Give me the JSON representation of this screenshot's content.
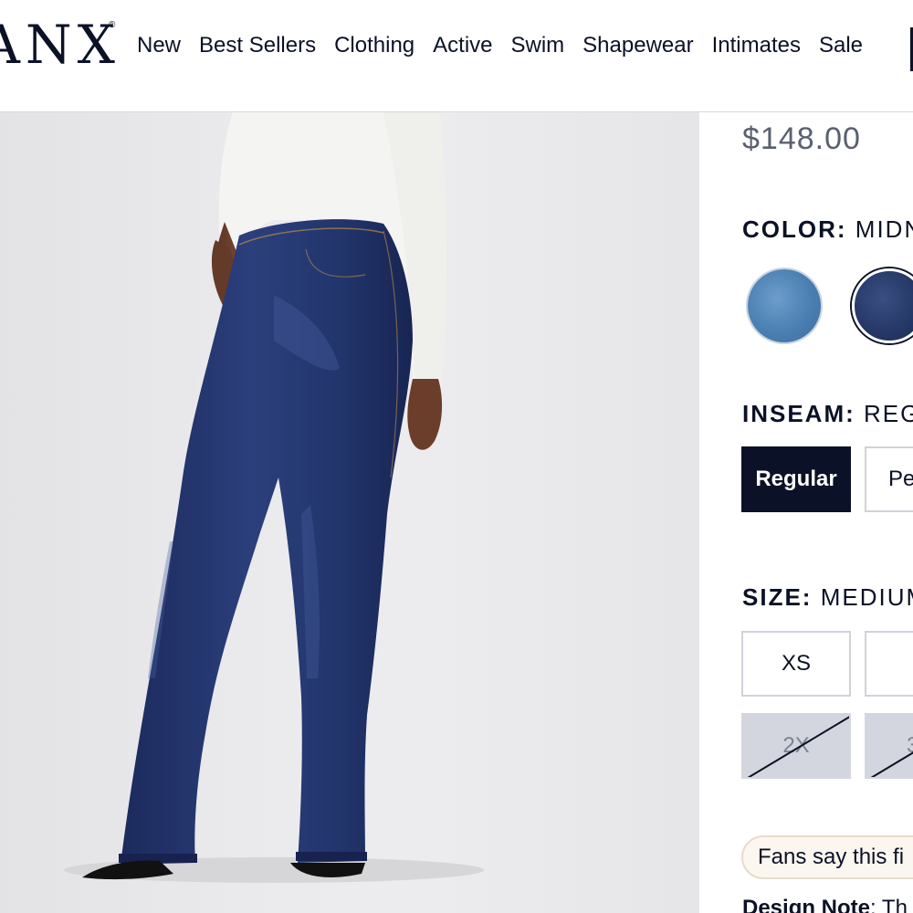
{
  "header": {
    "logo_text": "ANX",
    "logo_mark": "®",
    "nav": [
      "New",
      "Best Sellers",
      "Clothing",
      "Active",
      "Swim",
      "Shapewear",
      "Intimates",
      "Sale"
    ]
  },
  "product": {
    "price": "$148.00",
    "color": {
      "label": "COLOR:",
      "selected_value": "MIDN",
      "swatches": [
        {
          "name": "light-wash",
          "color": "#4a7fb2",
          "selected": false
        },
        {
          "name": "midnight",
          "color": "#243766",
          "selected": true
        }
      ]
    },
    "inseam": {
      "label": "INSEAM:",
      "selected_value": "REG",
      "options": [
        "Regular",
        "Pe"
      ]
    },
    "size": {
      "label": "SIZE:",
      "selected_value": "MEDIUM",
      "options": [
        {
          "label": "XS",
          "available": true
        },
        {
          "label": "",
          "available": true
        },
        {
          "label": "2X",
          "available": false
        },
        {
          "label": "3",
          "available": false
        }
      ]
    },
    "fans_text": "Fans say this fi",
    "design_note": {
      "label": "Design Note",
      "text": ": Th"
    }
  },
  "colors": {
    "brand_navy": "#0b1126",
    "price_gray": "#5a6070",
    "unavailable_gray": "#d3d6de",
    "pill_bg": "#fbf6ef"
  }
}
